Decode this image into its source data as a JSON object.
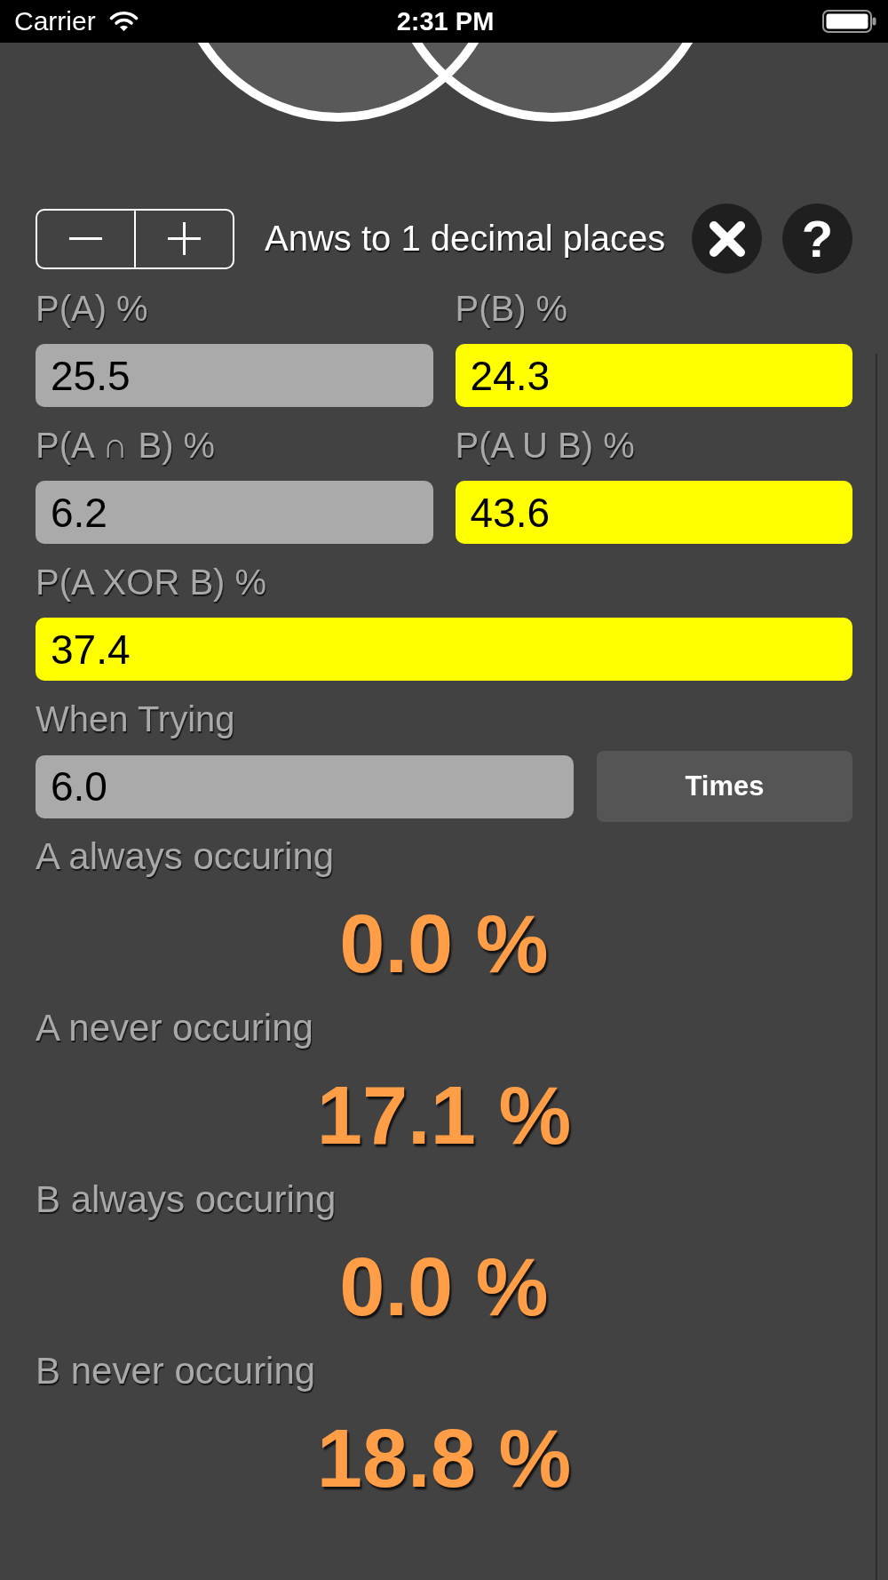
{
  "status_bar": {
    "carrier": "Carrier",
    "time": "2:31 PM"
  },
  "controls": {
    "decimals_label": "Anws to 1 decimal places",
    "help_button": "?"
  },
  "field_rows": [
    {
      "fields": [
        {
          "label": "P(A) %",
          "value": "25.5",
          "highlighted": false
        },
        {
          "label": "P(B) %",
          "value": "24.3",
          "highlighted": true
        }
      ]
    },
    {
      "fields": [
        {
          "label": "P(A ∩ B) %",
          "value": "6.2",
          "highlighted": false
        },
        {
          "label": "P(A U B) %",
          "value": "43.6",
          "highlighted": true
        }
      ]
    },
    {
      "fields": [
        {
          "label": "P(A XOR B) %",
          "value": "37.4",
          "highlighted": true
        }
      ]
    }
  ],
  "trials": {
    "label": "When Trying",
    "value": "6.0",
    "highlighted": false,
    "button": "Times"
  },
  "results": [
    {
      "label": "A always occuring",
      "value": "0.0 %"
    },
    {
      "label": "A never occuring",
      "value": "17.1 %"
    },
    {
      "label": "B always occuring",
      "value": "0.0 %"
    },
    {
      "label": "B never occuring",
      "value": "18.8 %"
    }
  ]
}
